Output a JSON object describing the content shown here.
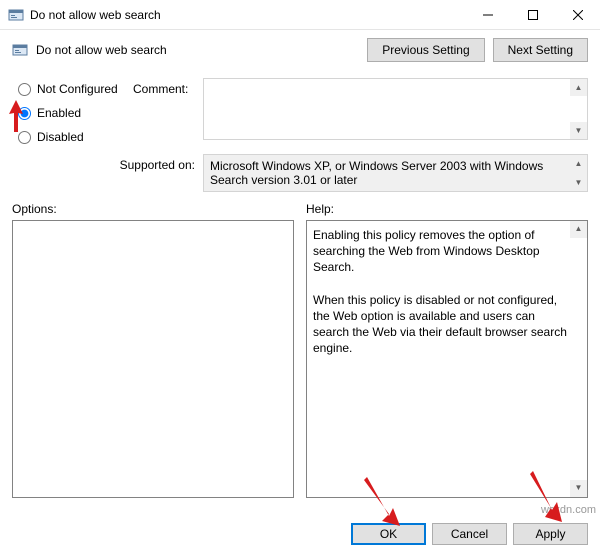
{
  "window": {
    "title": "Do not allow web search",
    "subtitle": "Do not allow web search"
  },
  "toolbar": {
    "previous": "Previous Setting",
    "next": "Next Setting"
  },
  "radios": {
    "not_configured": "Not Configured",
    "enabled": "Enabled",
    "disabled": "Disabled"
  },
  "labels": {
    "comment": "Comment:",
    "supported_on": "Supported on:",
    "options": "Options:",
    "help": "Help:"
  },
  "supported_text": "Microsoft Windows XP, or Windows Server 2003 with Windows Search version 3.01 or later",
  "help_text_p1": "Enabling this policy removes the option of searching the Web from Windows Desktop Search.",
  "help_text_p2": "When this policy is disabled or not configured, the Web option is available and users can search the Web via their default browser search engine.",
  "footer": {
    "ok": "OK",
    "cancel": "Cancel",
    "apply": "Apply"
  },
  "watermark": "wsxdn.com"
}
